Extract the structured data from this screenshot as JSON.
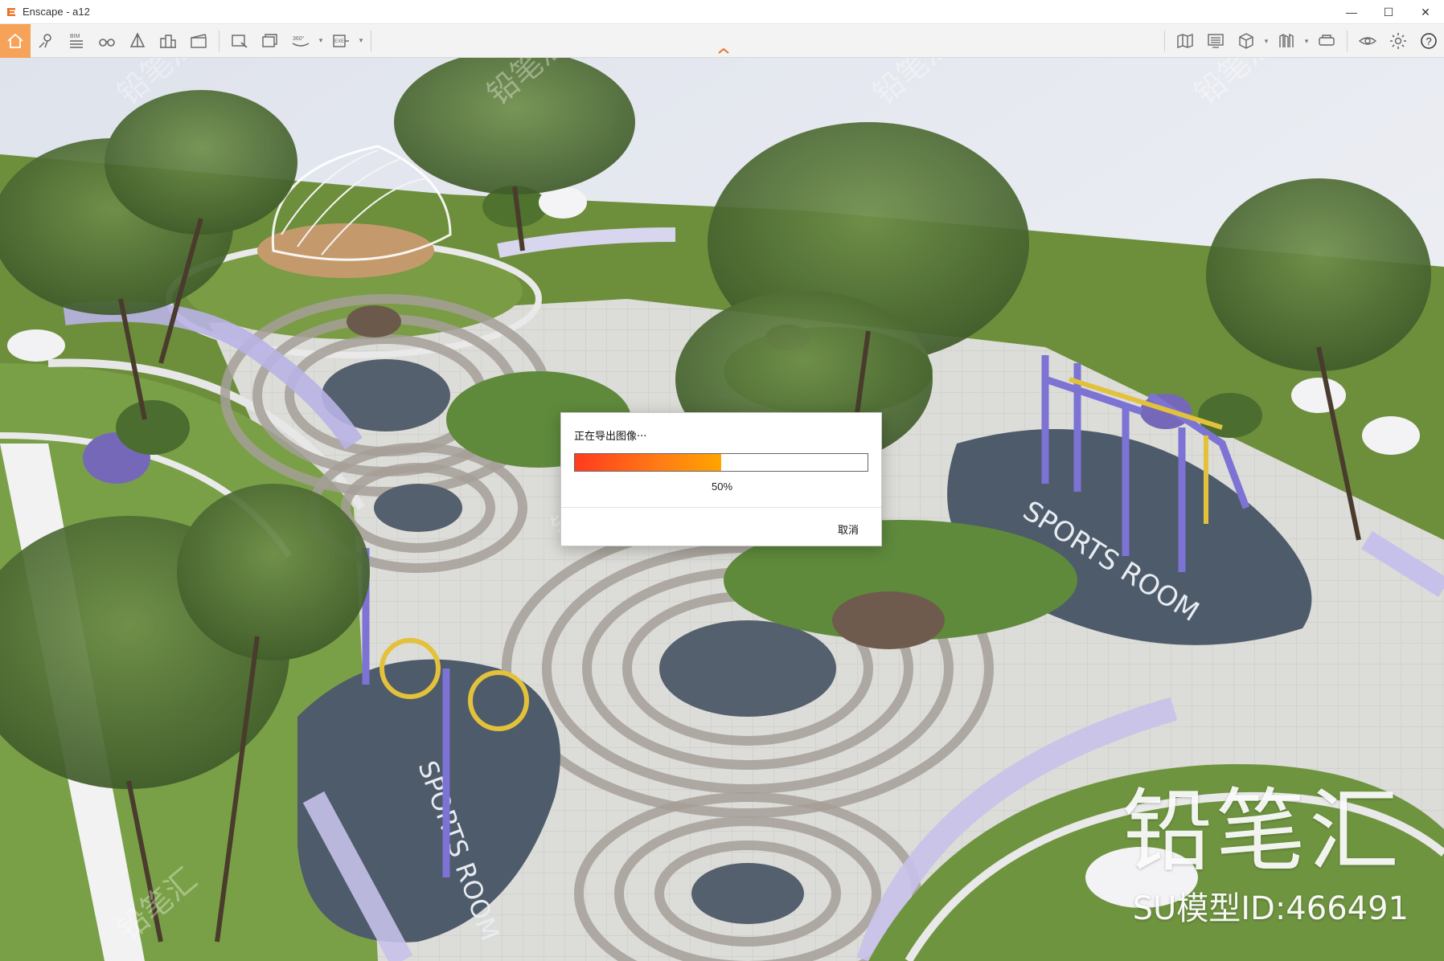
{
  "window": {
    "title": "Enscape - a12",
    "minimize_glyph": "—",
    "maximize_glyph": "☐",
    "close_glyph": "✕"
  },
  "toolbar": {
    "left_icons": [
      "home-icon",
      "location-pin-icon",
      "bim-icon",
      "binoculars-icon",
      "perspective-icon",
      "buildings-icon",
      "video-editor-icon",
      "screenshot-icon",
      "batch-render-icon",
      "panorama-360-icon",
      "export-exe-icon"
    ],
    "bim_label": "BIM",
    "pano_label": "360°",
    "exe_label": "EXE",
    "right_icons": [
      "map-icon",
      "monitor-icon",
      "cube-icon",
      "library-icon",
      "vr-headset-icon",
      "eye-icon",
      "gear-icon",
      "help-icon"
    ],
    "help_glyph": "?"
  },
  "dialog": {
    "title": "正在导出图像···",
    "progress_fraction": 0.5,
    "progress_label": "50%",
    "cancel_label": "取消"
  },
  "watermark": {
    "brand": "铅笔汇",
    "model_id": "SU模型ID:466491"
  },
  "colors": {
    "home_accent": "#f7a259",
    "progress_start": "#ff3b1f",
    "progress_end": "#ffa400"
  }
}
